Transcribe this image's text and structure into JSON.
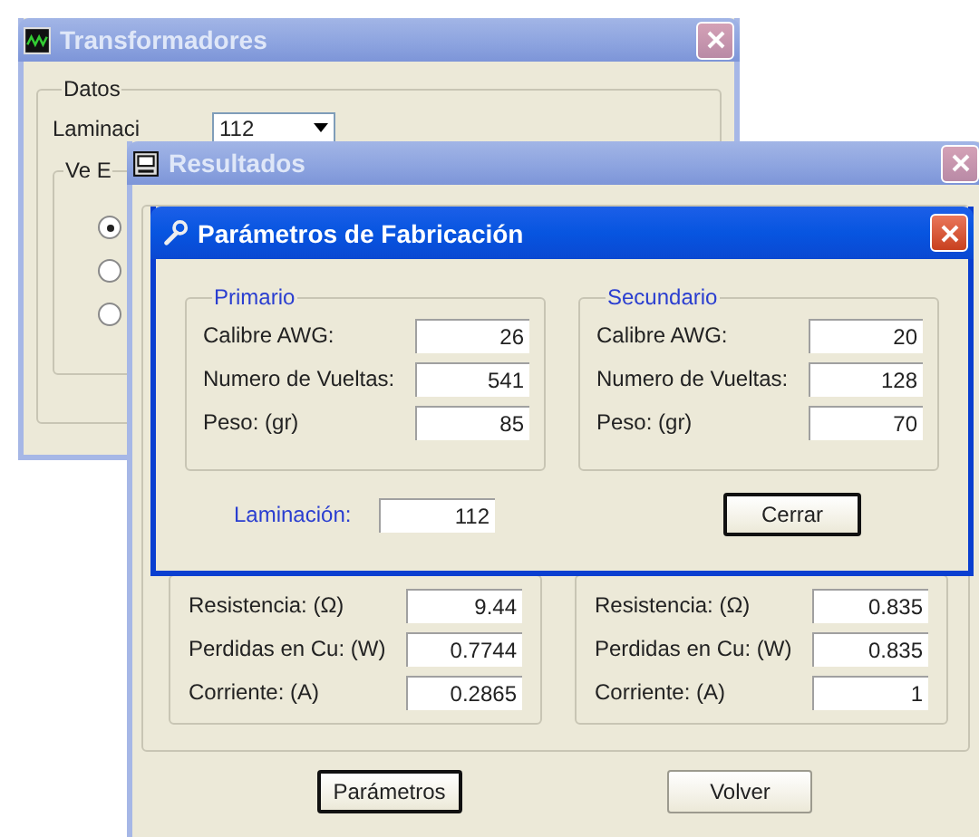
{
  "main_window": {
    "title": "Transformadores",
    "active": false,
    "group_title": "Datos",
    "laminacion_label": "Laminaci",
    "laminacion_value": "112",
    "sub_group_title": "Ve E",
    "radios": [
      {
        "selected": true
      },
      {
        "selected": false
      },
      {
        "selected": false
      }
    ]
  },
  "results_window": {
    "title": "Resultados",
    "active": false,
    "columns": [
      {
        "rows": [
          {
            "label": "Resistencia: (Ω)",
            "value": "9.44"
          },
          {
            "label": "Perdidas en Cu: (W)",
            "value": "0.7744"
          },
          {
            "label": "Corriente: (A)",
            "value": "0.2865"
          }
        ]
      },
      {
        "rows": [
          {
            "label": "Resistencia: (Ω)",
            "value": "0.835"
          },
          {
            "label": "Perdidas en Cu: (W)",
            "value": "0.835"
          },
          {
            "label": "Corriente: (A)",
            "value": "1"
          }
        ]
      }
    ],
    "buttons": [
      {
        "label": "Parámetros",
        "default": true
      },
      {
        "label": "Volver",
        "default": false
      }
    ]
  },
  "dialog": {
    "title": "Parámetros de Fabricación",
    "active": true,
    "groups": [
      {
        "title": "Primario",
        "rows": [
          {
            "label": "Calibre AWG:",
            "value": "26"
          },
          {
            "label": "Numero de Vueltas:",
            "value": "541"
          },
          {
            "label": "Peso: (gr)",
            "value": "85"
          }
        ]
      },
      {
        "title": "Secundario",
        "rows": [
          {
            "label": "Calibre AWG:",
            "value": "20"
          },
          {
            "label": "Numero de Vueltas:",
            "value": "128"
          },
          {
            "label": "Peso: (gr)",
            "value": "70"
          }
        ]
      }
    ],
    "laminacion_label": "Laminación:",
    "laminacion_value": "112",
    "close_button": "Cerrar"
  }
}
